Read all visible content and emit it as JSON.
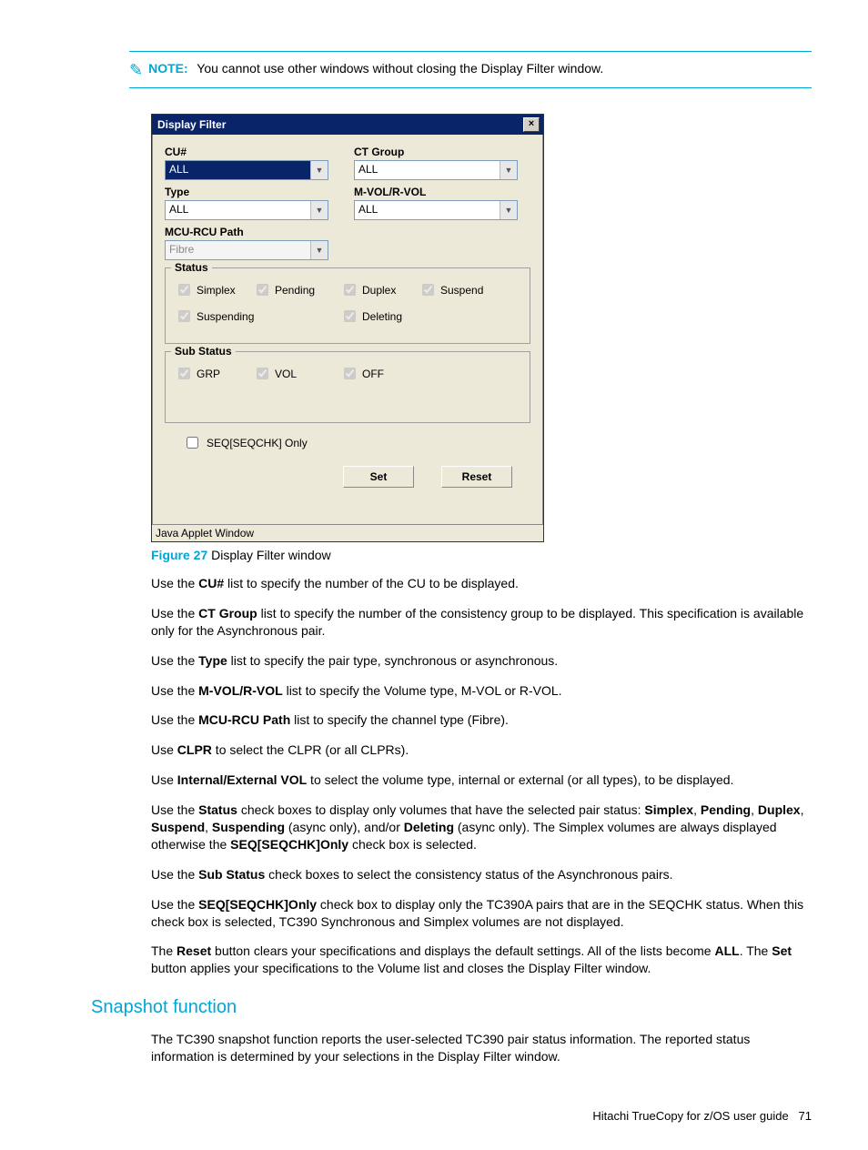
{
  "note": {
    "label": "NOTE:",
    "text": "You cannot use other windows without closing the Display Filter window."
  },
  "dialog": {
    "title": "Display Filter",
    "footer": "Java Applet Window",
    "fields": {
      "cu": {
        "label": "CU#",
        "value": "ALL"
      },
      "ctgroup": {
        "label": "CT Group",
        "value": "ALL"
      },
      "type": {
        "label": "Type",
        "value": "ALL"
      },
      "mvolrvol": {
        "label": "M-VOL/R-VOL",
        "value": "ALL"
      },
      "mcurcu": {
        "label": "MCU-RCU Path",
        "value": "Fibre"
      }
    },
    "status": {
      "title": "Status",
      "items": [
        "Simplex",
        "Pending",
        "Duplex",
        "Suspend",
        "Suspending",
        "Deleting"
      ]
    },
    "substatus": {
      "title": "Sub Status",
      "items": [
        "GRP",
        "VOL",
        "OFF"
      ]
    },
    "seqonly": "SEQ[SEQCHK] Only",
    "buttons": {
      "set": "Set",
      "reset": "Reset"
    }
  },
  "caption": {
    "label": "Figure 27",
    "text": "Display Filter window"
  },
  "paras": {
    "p1a": "Use the ",
    "p1b": "CU#",
    "p1c": " list to specify the number of the CU to be displayed.",
    "p2a": "Use the ",
    "p2b": "CT Group",
    "p2c": " list to specify the number of the consistency group to be displayed. This specification is available only for the Asynchronous pair.",
    "p3a": "Use the ",
    "p3b": "Type",
    "p3c": " list to specify the pair type, synchronous or asynchronous.",
    "p4a": "Use the ",
    "p4b": "M-VOL/R-VOL",
    "p4c": " list to specify the Volume type, M-VOL or R-VOL.",
    "p5a": "Use the ",
    "p5b": "MCU-RCU Path",
    "p5c": " list to specify the channel type (Fibre).",
    "p6a": "Use ",
    "p6b": "CLPR",
    "p6c": " to select the CLPR (or all CLPRs).",
    "p7a": "Use ",
    "p7b": "Internal/External VOL",
    "p7c": " to select the volume type, internal or external (or all types), to be displayed.",
    "p8a": "Use the ",
    "p8b": "Status",
    "p8c": " check boxes to display only volumes that have the selected pair status: ",
    "p8d": "Simplex",
    "p8e": ", ",
    "p8f": "Pending",
    "p8g": ", ",
    "p8h": "Duplex",
    "p8i": ", ",
    "p8j": "Suspend",
    "p8k": ", ",
    "p8l": "Suspending",
    "p8m": " (async only), and/or ",
    "p8n": "Deleting",
    "p8o": " (async only). The Simplex volumes are always displayed otherwise the ",
    "p8p": "SEQ[SEQCHK]Only",
    "p8q": " check box is selected.",
    "p9a": "Use the ",
    "p9b": "Sub Status",
    "p9c": " check boxes to select the consistency status of the Asynchronous pairs.",
    "p10a": "Use the ",
    "p10b": "SEQ[SEQCHK]Only",
    "p10c": " check box to display only the TC390A pairs that are in the SEQCHK status. When this check box is selected, TC390 Synchronous and Simplex volumes are not displayed.",
    "p11a": "The ",
    "p11b": "Reset",
    "p11c": " button clears your specifications and displays the default settings. All of the lists become ",
    "p11d": "ALL",
    "p11e": ". The ",
    "p11f": "Set",
    "p11g": " button applies your specifications to the Volume list and closes the Display Filter window."
  },
  "section": "Snapshot function",
  "section_text": "The TC390 snapshot function reports the user-selected TC390 pair status information. The reported status information is determined by your selections in the Display Filter window.",
  "footer": {
    "title": "Hitachi TrueCopy for z/OS user guide",
    "page": "71"
  }
}
